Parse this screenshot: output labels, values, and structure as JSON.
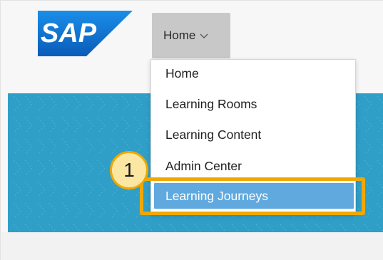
{
  "header": {
    "logo_text": "SAP",
    "home_menu_label": "Home",
    "chevron_icon": "chevron-down-icon"
  },
  "menu": {
    "items": [
      {
        "label": "Home"
      },
      {
        "label": "Learning Rooms"
      },
      {
        "label": "Learning Content"
      },
      {
        "label": "Admin Center"
      },
      {
        "label": "Learning Journeys",
        "selected": true
      }
    ]
  },
  "annotation": {
    "step_number": "1"
  },
  "colors": {
    "banner": "#2f9fc7",
    "selected_item": "#5fa9df",
    "highlight": "#f0a800",
    "badge_fill": "#fbe7a1",
    "logo_blue": "#0a6ed1"
  }
}
